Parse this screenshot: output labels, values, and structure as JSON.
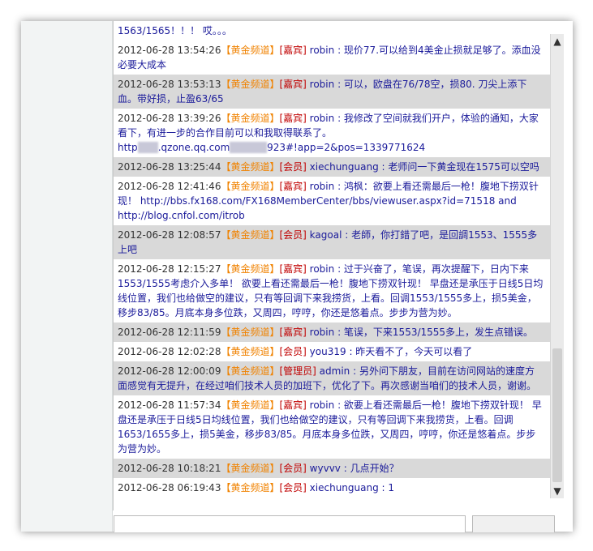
{
  "messages": [
    {
      "partial": "1563/1565！！！ 哎。。。"
    },
    {
      "time": "2012-06-28 13:54:26",
      "channel": "【黄金频道】",
      "role": "[嘉宾]",
      "user": "robin",
      "sep": " : ",
      "text": "现价77.可以给到4美金止损就足够了。添血没必要大成本"
    },
    {
      "time": "2012-06-28 13:53:13",
      "channel": "【黄金频道】",
      "role": "[嘉宾]",
      "user": "robin",
      "sep": " : ",
      "text": "可以，欧盘在76/78空，损80. 刀尖上添下血。带好损，止盈63/65"
    },
    {
      "time": "2012-06-28 13:39:26",
      "channel": "【黄金频道】",
      "role": "[嘉宾]",
      "user": "robin",
      "sep": " : ",
      "text": "我修改了空间就我们开户，体验的通知，大家看下，有进一步的合作目前可以和我取得联系了。 http",
      "blur1": "user",
      "text2": ".qzone.qq.com",
      "blur2": "000000",
      "text3": "923#!app=2&pos=1339771624"
    },
    {
      "time": "2012-06-28 13:25:44",
      "channel": "【黄金频道】",
      "role": "[会员]",
      "user": "xiechunguang",
      "sep": " : ",
      "text": "老师问一下黄金现在1575可以空吗"
    },
    {
      "time": "2012-06-28 12:41:46",
      "channel": "【黄金频道】",
      "role": "[嘉宾]",
      "user": "robin",
      "sep": " : ",
      "text": "鸿枫：欲要上看还需最后一枪！腹地下捞双针现！ http://bbs.fx168.com/FX168MemberCenter/bbs/viewuser.aspx?id=71518 and http://blog.cnfol.com/itrob"
    },
    {
      "time": "2012-06-28 12:08:57",
      "channel": "【黄金频道】",
      "role": "[会员]",
      "user": "kagoal",
      "sep": " : ",
      "text": "老師，你打錯了吧，是回調1553、1555多上吧"
    },
    {
      "time": "2012-06-28 12:15:27",
      "channel": "【黄金频道】",
      "role": "[嘉宾]",
      "user": "robin",
      "sep": " : ",
      "text": "过于兴奋了，笔误，再次提醒下，日内下来1553/1555考虑介入多单！ 欲要上看还需最后一枪！腹地下捞双针现！ 早盘还是承压于日线5日均线位置，我们也给做空的建议，只有等回调下来我捞货，上看。回调1553/1555多上，损5美金，移步83/85。月底本身多位跌，又周四，哼哼，你还是悠着点。步步为营为妙。"
    },
    {
      "time": "2012-06-28 12:11:59",
      "channel": "【黄金频道】",
      "role": "[嘉宾]",
      "user": "robin",
      "sep": " : ",
      "text": "笔误，下来1553/1555多上，发生点错误。"
    },
    {
      "time": "2012-06-28 12:02:28",
      "channel": "【黄金频道】",
      "role": "[会员]",
      "user": "you319",
      "sep": " : ",
      "text": "昨天看不了，今天可以看了"
    },
    {
      "time": "2012-06-28 12:00:09",
      "channel": "【黄金频道】",
      "role": "[管理员]",
      "user": "admin",
      "sep": " : ",
      "text": "另外问下朋友，目前在访问网站的速度方面感觉有无提升，在经过咱们技术人员的加班下，优化了下。再次感谢当咱们的技术人员，谢谢。"
    },
    {
      "time": "2012-06-28 11:57:34",
      "channel": "【黄金频道】",
      "role": "[嘉宾]",
      "user": "robin",
      "sep": " : ",
      "text": "欲要上看还需最后一枪！腹地下捞双针现！ 早盘还是承压于日线5日均线位置，我们也给做空的建议，只有等回调下来我捞货，上看。回调1653/1655多上，损5美金，移步83/85。月底本身多位跌，又周四，哼哼，你还是悠着点。步步为营为妙。"
    },
    {
      "time": "2012-06-28 10:18:21",
      "channel": "【黄金频道】",
      "role": "[会员]",
      "user": "wyvvv",
      "sep": " : ",
      "text": "几点开始？"
    },
    {
      "time": "2012-06-28 06:19:43",
      "channel": "【黄金频道】",
      "role": "[会员]",
      "user": "xiechunguang",
      "sep": " : ",
      "text": "1"
    }
  ],
  "scrollbar": {
    "up": "▲",
    "down": "▼"
  }
}
